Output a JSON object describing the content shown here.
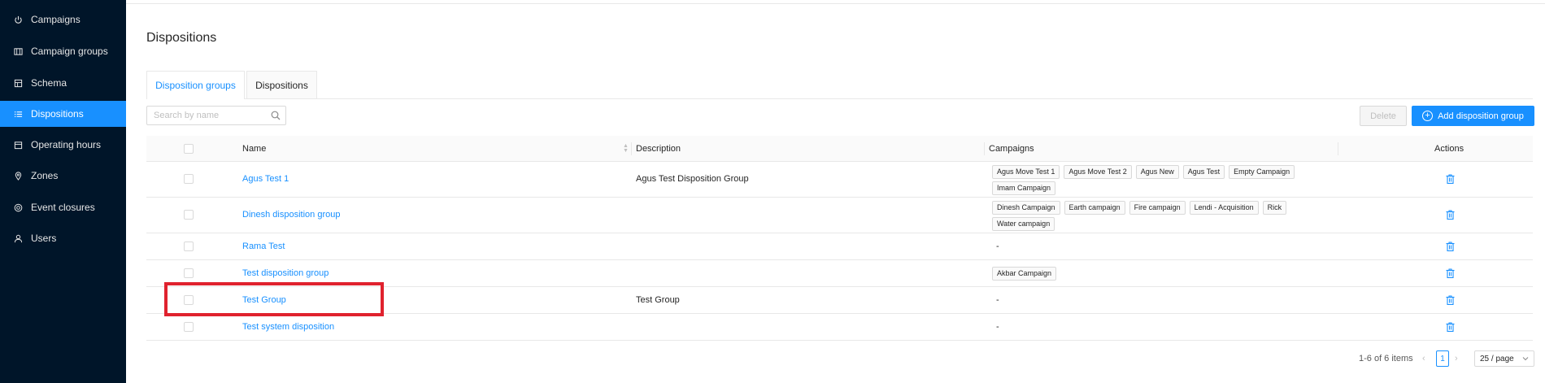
{
  "sidebar": {
    "items": [
      {
        "label": "Campaigns",
        "icon": "power-icon",
        "active": false
      },
      {
        "label": "Campaign groups",
        "icon": "layers-icon",
        "active": false
      },
      {
        "label": "Schema",
        "icon": "schema-icon",
        "active": false
      },
      {
        "label": "Dispositions",
        "icon": "list-icon",
        "active": true
      },
      {
        "label": "Operating hours",
        "icon": "calendar-icon",
        "active": false
      },
      {
        "label": "Zones",
        "icon": "location-pin-icon",
        "active": false
      },
      {
        "label": "Event closures",
        "icon": "target-icon",
        "active": false
      },
      {
        "label": "Users",
        "icon": "user-icon",
        "active": false
      }
    ]
  },
  "page": {
    "title": "Dispositions"
  },
  "tabs": [
    {
      "label": "Disposition groups",
      "active": true
    },
    {
      "label": "Dispositions",
      "active": false
    }
  ],
  "search": {
    "placeholder": "Search by name",
    "value": ""
  },
  "toolbar": {
    "delete_label": "Delete",
    "add_label": "Add disposition group"
  },
  "table": {
    "columns": {
      "name": "Name",
      "description": "Description",
      "campaigns": "Campaigns",
      "actions": "Actions"
    },
    "rows": [
      {
        "name": "Agus Test 1",
        "description": "Agus Test Disposition Group",
        "campaigns": [
          "Agus Move Test 1",
          "Agus Move Test 2",
          "Agus New",
          "Agus Test",
          "Empty Campaign",
          "Imam Campaign"
        ],
        "empty": ""
      },
      {
        "name": "Dinesh disposition group",
        "description": "",
        "campaigns": [
          "Dinesh Campaign",
          "Earth campaign",
          "Fire campaign",
          "Lendi - Acquisition",
          "Rick",
          "Water campaign"
        ],
        "empty": ""
      },
      {
        "name": "Rama Test",
        "description": "",
        "campaigns": [],
        "empty": "-"
      },
      {
        "name": "Test disposition group",
        "description": "",
        "campaigns": [
          "Akbar Campaign"
        ],
        "empty": ""
      },
      {
        "name": "Test Group",
        "description": "Test Group",
        "campaigns": [],
        "empty": "-"
      },
      {
        "name": "Test system disposition",
        "description": "",
        "campaigns": [],
        "empty": "-"
      }
    ]
  },
  "pagination": {
    "total_label": "1-6 of 6 items",
    "current_page": "1",
    "page_size": "25 / page",
    "prev": "‹",
    "next": "›"
  },
  "colors": {
    "sidebar_bg": "#001529",
    "accent": "#1890ff",
    "highlight_box": "#e0222e"
  }
}
